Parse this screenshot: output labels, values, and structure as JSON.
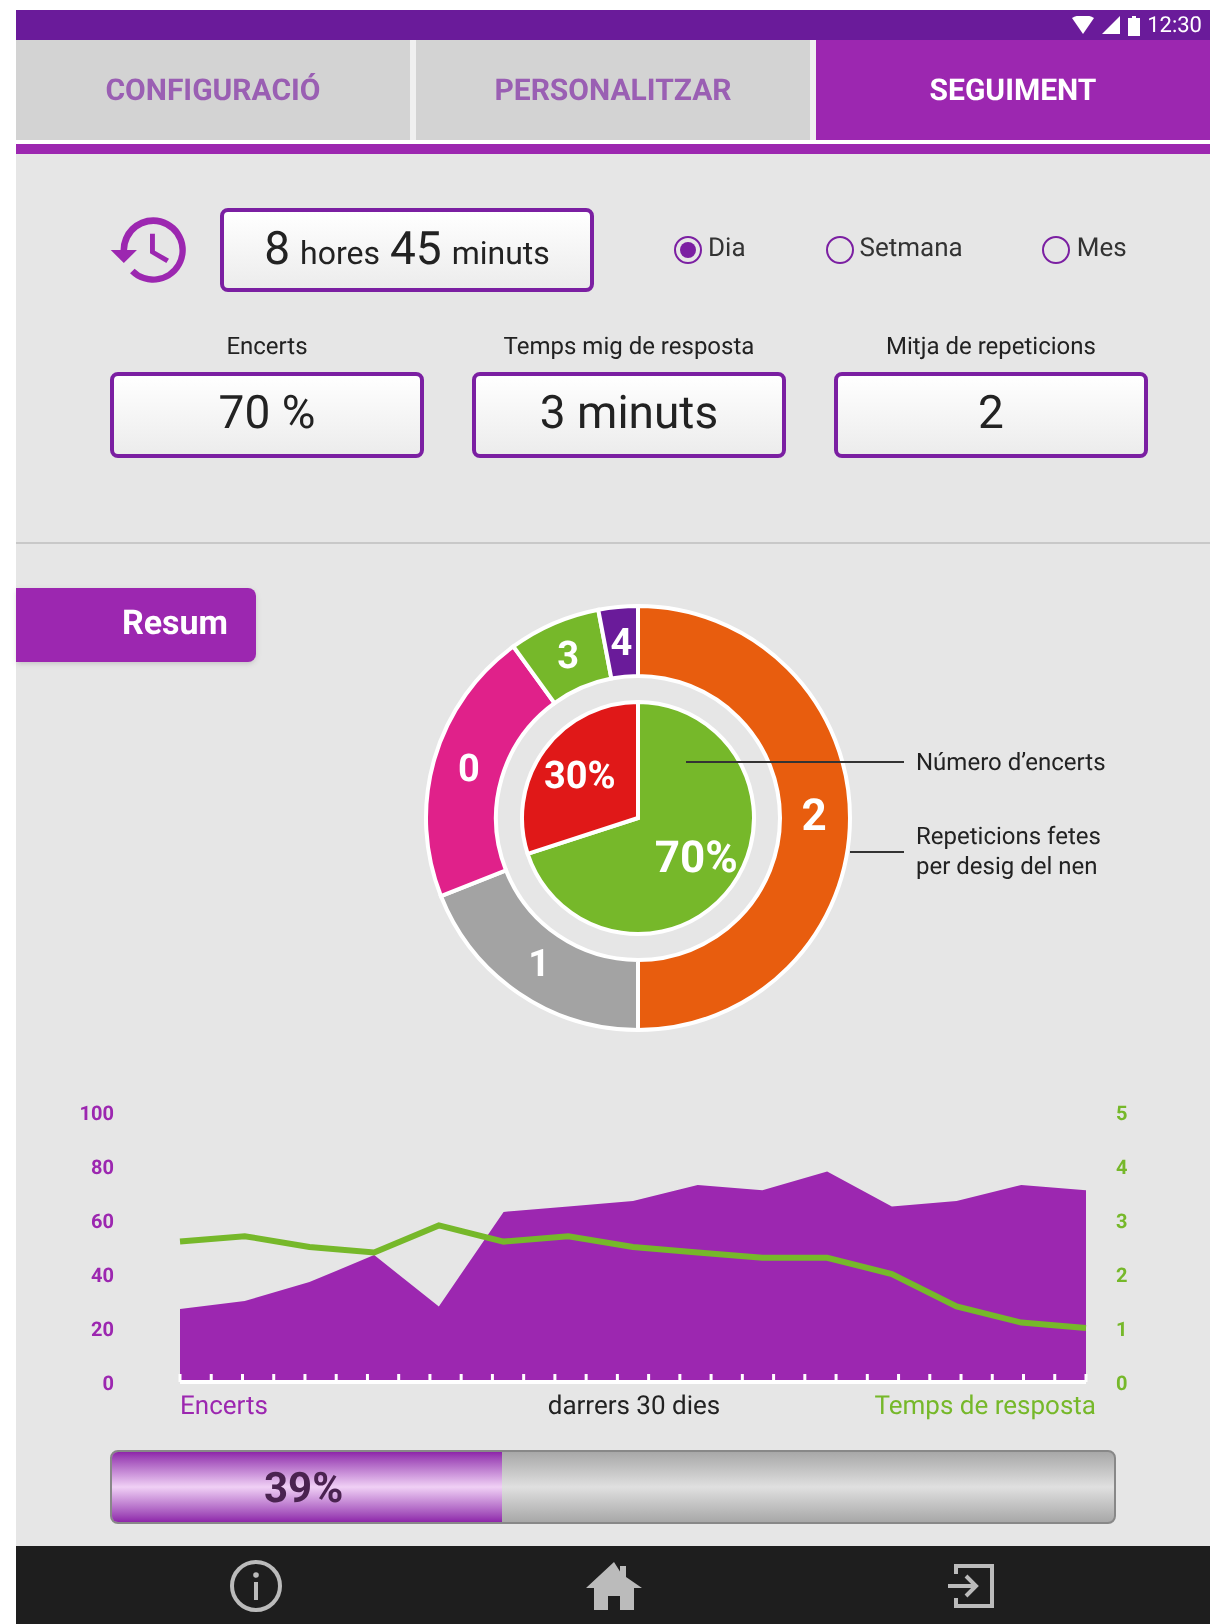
{
  "status_bar": {
    "time": "12:30"
  },
  "tabs": [
    {
      "label": "CONFIGURACIÓ",
      "selected": false
    },
    {
      "label": "PERSONALITZAR",
      "selected": false
    },
    {
      "label": "SEGUIMENT",
      "selected": true
    }
  ],
  "usage": {
    "hours": "8",
    "hours_unit": "hores",
    "minutes": "45",
    "minutes_unit": "minuts"
  },
  "periods": [
    {
      "label": "Dia",
      "selected": true
    },
    {
      "label": "Setmana",
      "selected": false
    },
    {
      "label": "Mes",
      "selected": false
    }
  ],
  "stats": [
    {
      "label": "Encerts",
      "value": "70 %"
    },
    {
      "label": "Temps mig de resposta",
      "value": "3 minuts"
    },
    {
      "label": "Mitja de repeticions",
      "value": "2"
    }
  ],
  "summary": {
    "title": "Resum",
    "outer_chart": {
      "chart_data": {
        "type": "donut",
        "categories": [
          "2",
          "1",
          "0",
          "3",
          "4"
        ],
        "values": [
          50,
          19,
          21,
          7,
          3
        ],
        "colors": [
          "#e85d0e",
          "#a3a3a3",
          "#e0218a",
          "#76b82a",
          "#6a1b9a"
        ]
      }
    },
    "inner_chart": {
      "chart_data": {
        "type": "pie",
        "categories": [
          "70%",
          "30%"
        ],
        "values": [
          70,
          30
        ],
        "colors": [
          "#76b82a",
          "#e01818"
        ]
      }
    },
    "legend": [
      "Número d’encerts",
      "Repeticions fetes per desig del nen"
    ]
  },
  "trend": {
    "chart_data": {
      "type": "area",
      "xlabel": "darrers 30 dies",
      "ylim": [
        0,
        100
      ],
      "yticks": [
        0,
        20,
        40,
        60,
        80,
        100
      ],
      "y2lim": [
        0,
        5
      ],
      "y2ticks": [
        0,
        1,
        2,
        3,
        4,
        5
      ],
      "series": [
        {
          "name": "Encerts",
          "type": "area",
          "color": "#9c27b0",
          "values": [
            27,
            30,
            37,
            47,
            28,
            63,
            65,
            67,
            73,
            71,
            78,
            65,
            67,
            73,
            71
          ]
        },
        {
          "name": "Temps de resposta",
          "type": "line",
          "axis": "y2",
          "color": "#76b82a",
          "values": [
            2.6,
            2.7,
            2.5,
            2.4,
            2.9,
            2.6,
            2.7,
            2.5,
            2.4,
            2.3,
            2.3,
            2.0,
            1.4,
            1.1,
            1.0
          ]
        }
      ]
    }
  },
  "progress": {
    "level": 0.39,
    "reading": "39%"
  }
}
